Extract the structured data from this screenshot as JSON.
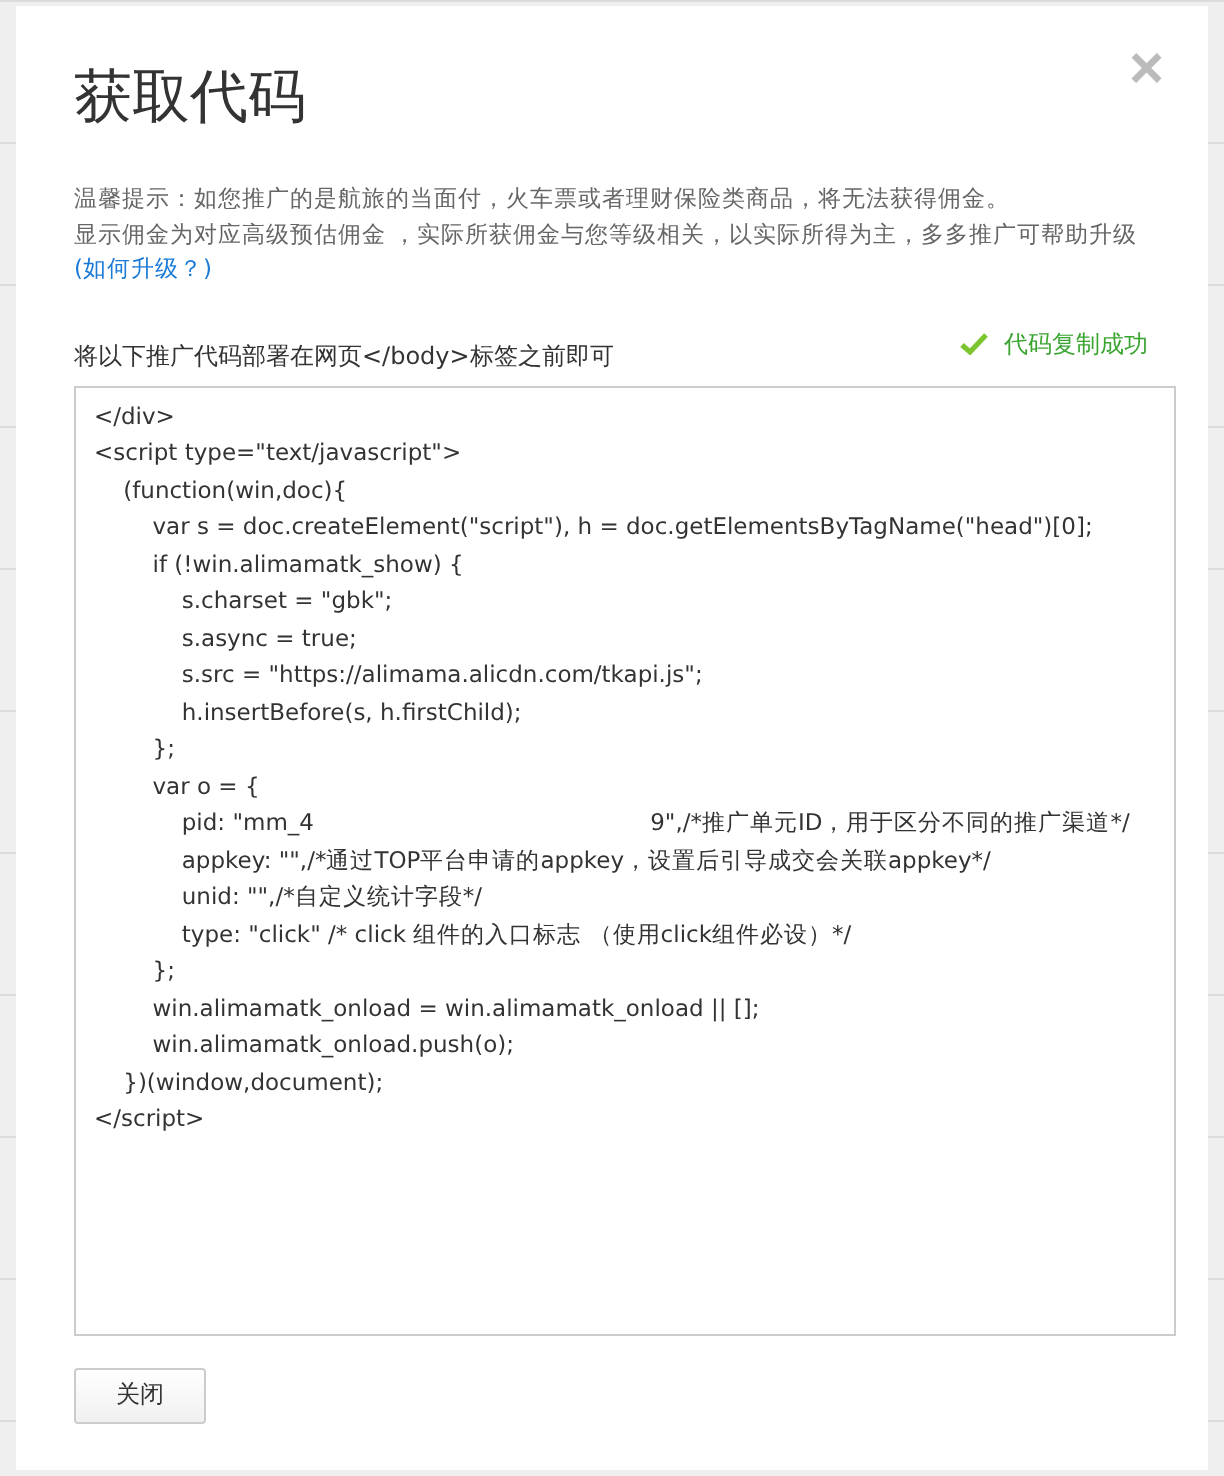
{
  "dialog": {
    "title": "获取代码",
    "close_icon": "×",
    "tips": [
      "温馨提示：如您推广的是航旅的当面付，火车票或者理财保险类商品，将无法获得佣金。",
      "显示佣金为对应高级预估佣金 ，实际所获佣金与您等级相关，以实际所得为主，多多推广可帮助升级"
    ],
    "upgrade_link": "(如何升级？)",
    "code_label": "将以下推广代码部署在网页</body>标签之前即可",
    "copy_status": "代码复制成功",
    "code": "</div>\n<script type=\"text/javascript\">\n    (function(win,doc){\n        var s = doc.createElement(\"script\"), h = doc.getElementsByTagName(\"head\")[0];\n        if (!win.alimamatk_show) {\n            s.charset = \"gbk\";\n            s.async = true;\n            s.src = \"https://alimama.alicdn.com/tkapi.js\";\n            h.insertBefore(s, h.firstChild);\n        };\n        var o = {\n            pid: \"mm_4                                              9\",/*推广单元ID，用于区分不同的推广渠道*/\n            appkey: \"\",/*通过TOP平台申请的appkey，设置后引导成交会关联appkey*/\n            unid: \"\",/*自定义统计字段*/\n            type: \"click\" /* click 组件的入口标志 （使用click组件必设）*/\n        };\n        win.alimamatk_onload = win.alimamatk_onload || [];\n        win.alimamatk_onload.push(o);\n    })(window,document);\n</script>",
    "buttons": [
      "关闭"
    ]
  }
}
